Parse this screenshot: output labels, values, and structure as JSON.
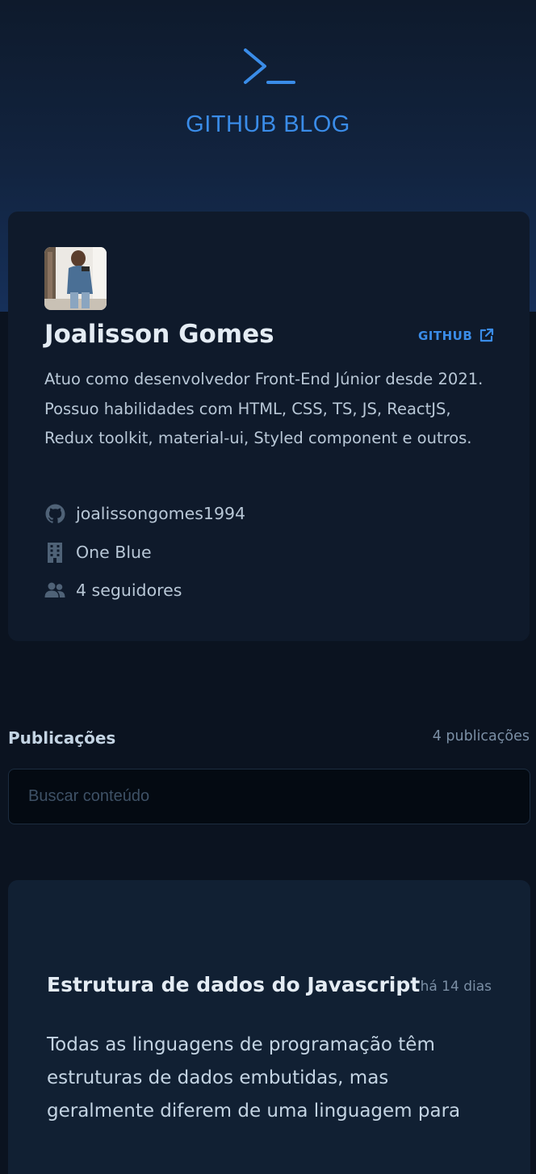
{
  "header": {
    "logo_icon": "terminal-prompt-icon",
    "title": "GITHUB BLOG"
  },
  "profile": {
    "name": "Joalisson Gomes",
    "github_link_label": "GITHUB",
    "github_link_icon": "external-link-icon",
    "bio": "Atuo como desenvolvedor Front-End Júnior desde 2021. Possuo habilidades com HTML, CSS, TS, JS, ReactJS, Redux toolkit, material-ui, Styled component e outros.",
    "username": "joalissongomes1994",
    "company": "One Blue",
    "followers": "4 seguidores"
  },
  "publications": {
    "title": "Publicações",
    "count_label": "4 publicações",
    "search_placeholder": "Buscar conteúdo"
  },
  "posts": [
    {
      "title": "Estrutura de dados do Javascript",
      "date": "há 14 dias",
      "excerpt": "Todas as linguagens de programação têm estruturas de dados embutidas, mas geralmente diferem de uma linguagem para"
    }
  ],
  "colors": {
    "background": "#0b1320",
    "card": "#0f1a2b",
    "post_card": "#112033",
    "accent": "#3a8ce8",
    "title_text": "#e4ecf4",
    "body_text": "#b8c7d6",
    "muted_text": "#7b8fa5"
  }
}
